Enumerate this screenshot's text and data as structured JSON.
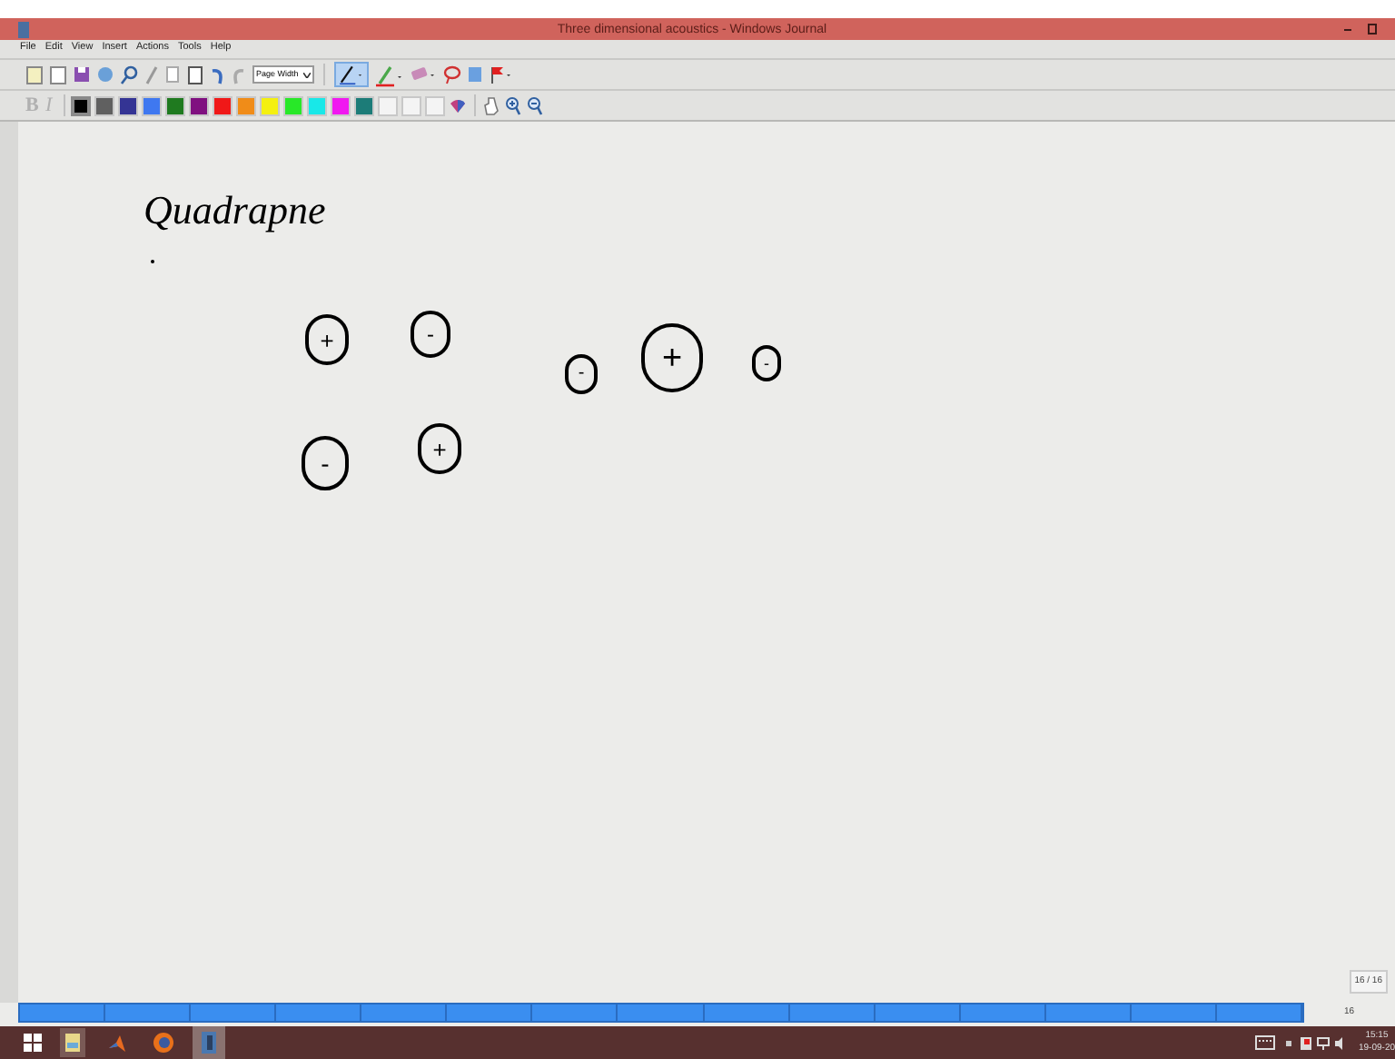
{
  "window": {
    "title": "Three dimensional acoustics - Windows Journal"
  },
  "menu": [
    "File",
    "Edit",
    "View",
    "Insert",
    "Actions",
    "Tools",
    "Help"
  ],
  "toolbar": {
    "zoom_value": "Page Width",
    "pen_selected": true
  },
  "palette": [
    {
      "color": "#000000",
      "selected": true
    },
    {
      "color": "#606060",
      "selected": false
    },
    {
      "color": "#343494",
      "selected": false
    },
    {
      "color": "#3f78f0",
      "selected": false
    },
    {
      "color": "#1f7a1f",
      "selected": false
    },
    {
      "color": "#801080",
      "selected": false
    },
    {
      "color": "#f01818",
      "selected": false
    },
    {
      "color": "#f08c18",
      "selected": false
    },
    {
      "color": "#f4f010",
      "selected": false
    },
    {
      "color": "#28e828",
      "selected": false
    },
    {
      "color": "#18e8e8",
      "selected": false
    },
    {
      "color": "#f018f0",
      "selected": false
    },
    {
      "color": "#1c7c78",
      "selected": false
    },
    {
      "color": "#f4f4f4",
      "selected": false
    },
    {
      "color": "#f4f4f4",
      "selected": false
    },
    {
      "color": "#f4f4f4",
      "selected": false
    }
  ],
  "note": {
    "heading": "Quadrapne",
    "charges": [
      {
        "sign": "+"
      },
      {
        "sign": "-"
      },
      {
        "sign": "-"
      },
      {
        "sign": "+"
      },
      {
        "sign": "-"
      },
      {
        "sign": "+"
      },
      {
        "sign": "-"
      }
    ]
  },
  "page_indicator": "16 / 16",
  "page_bar": {
    "label": "16"
  },
  "format_buttons": [
    "B",
    "I"
  ],
  "taskbar": {
    "time": "15:15",
    "date": "19-09-20"
  }
}
